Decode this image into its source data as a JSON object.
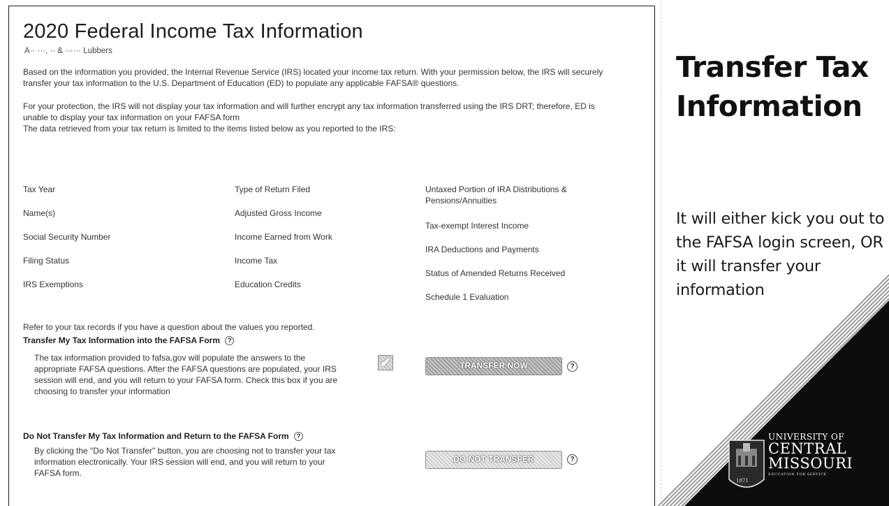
{
  "document": {
    "title": "2020 Federal Income Tax Information",
    "names": "A·· ···, ·· & ······ Lubbers",
    "para1": "Based on the information you provided, the Internal Revenue Service (IRS) located your income tax return. With your permission below, the IRS will securely transfer your tax information to the U.S. Department of Education (ED) to populate any applicable FAFSA® questions.",
    "para2": "For your protection, the IRS will not display your tax information and will further encrypt any tax information transferred using the IRS DRT; therefore, ED is unable to display your tax information on your FAFSA form",
    "para3": "The data retrieved from your tax return is limited to the items listed below as you reported to the IRS:",
    "items_col1": [
      "Tax Year",
      "Name(s)",
      "Social Security Number",
      "Filing Status",
      "IRS Exemptions"
    ],
    "items_col2": [
      "Type of Return Filed",
      "Adjusted Gross Income",
      "Income Earned from Work",
      "Income Tax",
      "Education Credits"
    ],
    "items_col3": [
      "Untaxed Portion of IRA Distributions & Pensions/Annuities",
      "Tax-exempt Interest Income",
      "IRA Deductions and Payments",
      "Status of Amended Returns Received",
      "Schedule 1 Evaluation"
    ],
    "refer": "Refer to your tax records if you have a question about the values you reported.",
    "transfer_section": {
      "heading": "Transfer My Tax Information into the FAFSA Form",
      "help": "?",
      "text": "The tax information provided to fafsa.gov will populate the answers to the appropriate FAFSA questions. After the FAFSA questions are populated, your IRS session will end, and you will return to your FAFSA form. Check this box if you are choosing to transfer your information",
      "checkbox_mark": "✔",
      "button_label": "TRANSFER NOW",
      "button_help": "?"
    },
    "no_transfer_section": {
      "heading": "Do Not Transfer My Tax Information and Return to the FAFSA Form",
      "help": "?",
      "text": "By clicking the \"Do Not Transfer\" button, you are choosing not to transfer your tax information electronically. Your IRS session will end, and you will return to your FAFSA form.",
      "button_label": "DO NOT TRANSFER",
      "button_help": "?"
    }
  },
  "slide": {
    "title_line1": "Transfer Tax",
    "title_line2": "Information",
    "body": "It will either kick you out to the FAFSA login screen, OR it will transfer your information"
  },
  "logo": {
    "line1": "UNIVERSITY OF",
    "line2": "CENTRAL",
    "line3": "MISSOURI",
    "tagline": "EDUCATION FOR SERVICE",
    "seal_year": "1871"
  },
  "colors": {
    "slide_black": "#0d0d0d",
    "panel_border": "#1a1a1a"
  }
}
